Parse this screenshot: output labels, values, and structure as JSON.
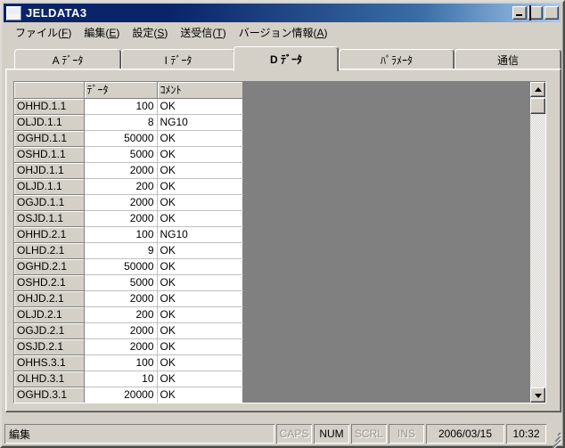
{
  "window": {
    "title": "JELDATA3",
    "icon": "application-icon",
    "buttons": {
      "minimize": "minimize-button",
      "maximize": "maximize-button",
      "close": "close-button"
    }
  },
  "menubar": {
    "items": [
      {
        "label": "ファイル(F)",
        "text": "ファイル(",
        "mnemonic": "F",
        "tail": ")"
      },
      {
        "label": "編集(E)",
        "text": "編集(",
        "mnemonic": "E",
        "tail": ")"
      },
      {
        "label": "設定(S)",
        "text": "設定(",
        "mnemonic": "S",
        "tail": ")"
      },
      {
        "label": "送受信(T)",
        "text": "送受信(",
        "mnemonic": "T",
        "tail": ")"
      },
      {
        "label": "バージョン情報(A)",
        "text": "バージョン情報(",
        "mnemonic": "A",
        "tail": ")"
      }
    ]
  },
  "tabs": {
    "selected_index": 2,
    "items": [
      {
        "label": "A ﾃﾞｰﾀ",
        "selected": false
      },
      {
        "label": "I ﾃﾞｰﾀ",
        "selected": false
      },
      {
        "label": "D ﾃﾞｰﾀ",
        "selected": true
      },
      {
        "label": "ﾊﾟﾗﾒｰﾀ",
        "selected": false
      },
      {
        "label": "通信",
        "selected": false
      }
    ]
  },
  "grid": {
    "columns": [
      "",
      "ﾃﾞｰﾀ",
      "ｺﾒﾝﾄ"
    ],
    "rows": [
      {
        "name": "OHHD.1.1",
        "value": "100",
        "comment": "OK"
      },
      {
        "name": "OLJD.1.1",
        "value": "8",
        "comment": "NG10"
      },
      {
        "name": "OGHD.1.1",
        "value": "50000",
        "comment": "OK"
      },
      {
        "name": "OSHD.1.1",
        "value": "5000",
        "comment": "OK"
      },
      {
        "name": "OHJD.1.1",
        "value": "2000",
        "comment": "OK"
      },
      {
        "name": "OLJD.1.1",
        "value": "200",
        "comment": "OK"
      },
      {
        "name": "OGJD.1.1",
        "value": "2000",
        "comment": "OK"
      },
      {
        "name": "OSJD.1.1",
        "value": "2000",
        "comment": "OK"
      },
      {
        "name": "OHHD.2.1",
        "value": "100",
        "comment": "NG10"
      },
      {
        "name": "OLHD.2.1",
        "value": "9",
        "comment": "OK"
      },
      {
        "name": "OGHD.2.1",
        "value": "50000",
        "comment": "OK"
      },
      {
        "name": "OSHD.2.1",
        "value": "5000",
        "comment": "OK"
      },
      {
        "name": "OHJD.2.1",
        "value": "2000",
        "comment": "OK"
      },
      {
        "name": "OLJD.2.1",
        "value": "200",
        "comment": "OK"
      },
      {
        "name": "OGJD.2.1",
        "value": "2000",
        "comment": "OK"
      },
      {
        "name": "OSJD.2.1",
        "value": "2000",
        "comment": "OK"
      },
      {
        "name": "OHHS.3.1",
        "value": "100",
        "comment": "OK"
      },
      {
        "name": "OLHD.3.1",
        "value": "10",
        "comment": "OK"
      },
      {
        "name": "OGHD.3.1",
        "value": "20000",
        "comment": "OK"
      }
    ]
  },
  "scrollbar": {
    "up_icon": "scroll-up-arrow-icon",
    "down_icon": "scroll-down-arrow-icon"
  },
  "statusbar": {
    "message": "編集",
    "indicators": [
      {
        "label": "CAPS",
        "active": false
      },
      {
        "label": "NUM",
        "active": true
      },
      {
        "label": "SCRL",
        "active": false
      },
      {
        "label": "INS",
        "active": false
      }
    ],
    "date": "2006/03/15",
    "time": "10:32"
  },
  "colors": {
    "title_start": "#0a246a",
    "title_end": "#a6caf0",
    "face": "#d4d0c8",
    "grid_empty": "#808080",
    "cell_bg": "#ffffff"
  }
}
